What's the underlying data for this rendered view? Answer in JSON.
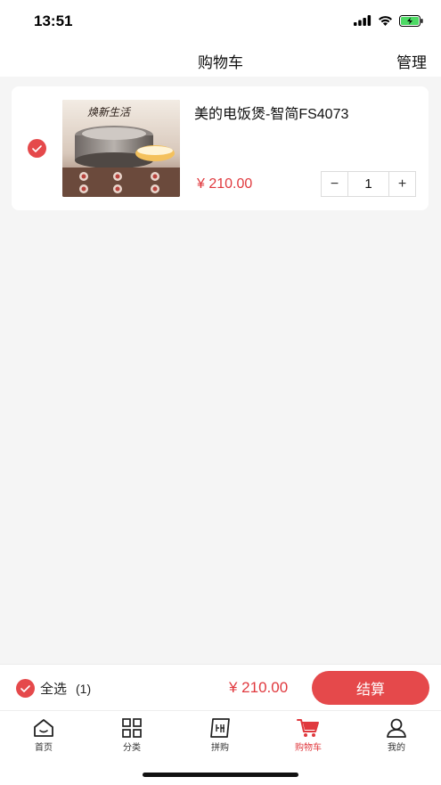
{
  "status": {
    "time": "13:51"
  },
  "nav": {
    "title": "购物车",
    "manage_label": "管理"
  },
  "cart": {
    "items": [
      {
        "name": "美的电饭煲-智简FS4073",
        "price": "¥ 210.00",
        "quantity": "1",
        "selected": true,
        "image_text": "焕新生活"
      }
    ],
    "stepper": {
      "minus": "−",
      "plus": "+"
    }
  },
  "checkout": {
    "select_all_label": "全选",
    "select_count": "(1)",
    "total": "¥ 210.00",
    "button_label": "结算"
  },
  "tabs": [
    {
      "label": "首页",
      "icon": "home-icon",
      "active": false
    },
    {
      "label": "分类",
      "icon": "grid-icon",
      "active": false
    },
    {
      "label": "拼购",
      "icon": "group-buy-icon",
      "active": false
    },
    {
      "label": "购物车",
      "icon": "cart-icon",
      "active": true
    },
    {
      "label": "我的",
      "icon": "user-icon",
      "active": false
    }
  ],
  "colors": {
    "accent": "#e5494b",
    "price": "#e0393e",
    "background": "#f5f5f5"
  }
}
